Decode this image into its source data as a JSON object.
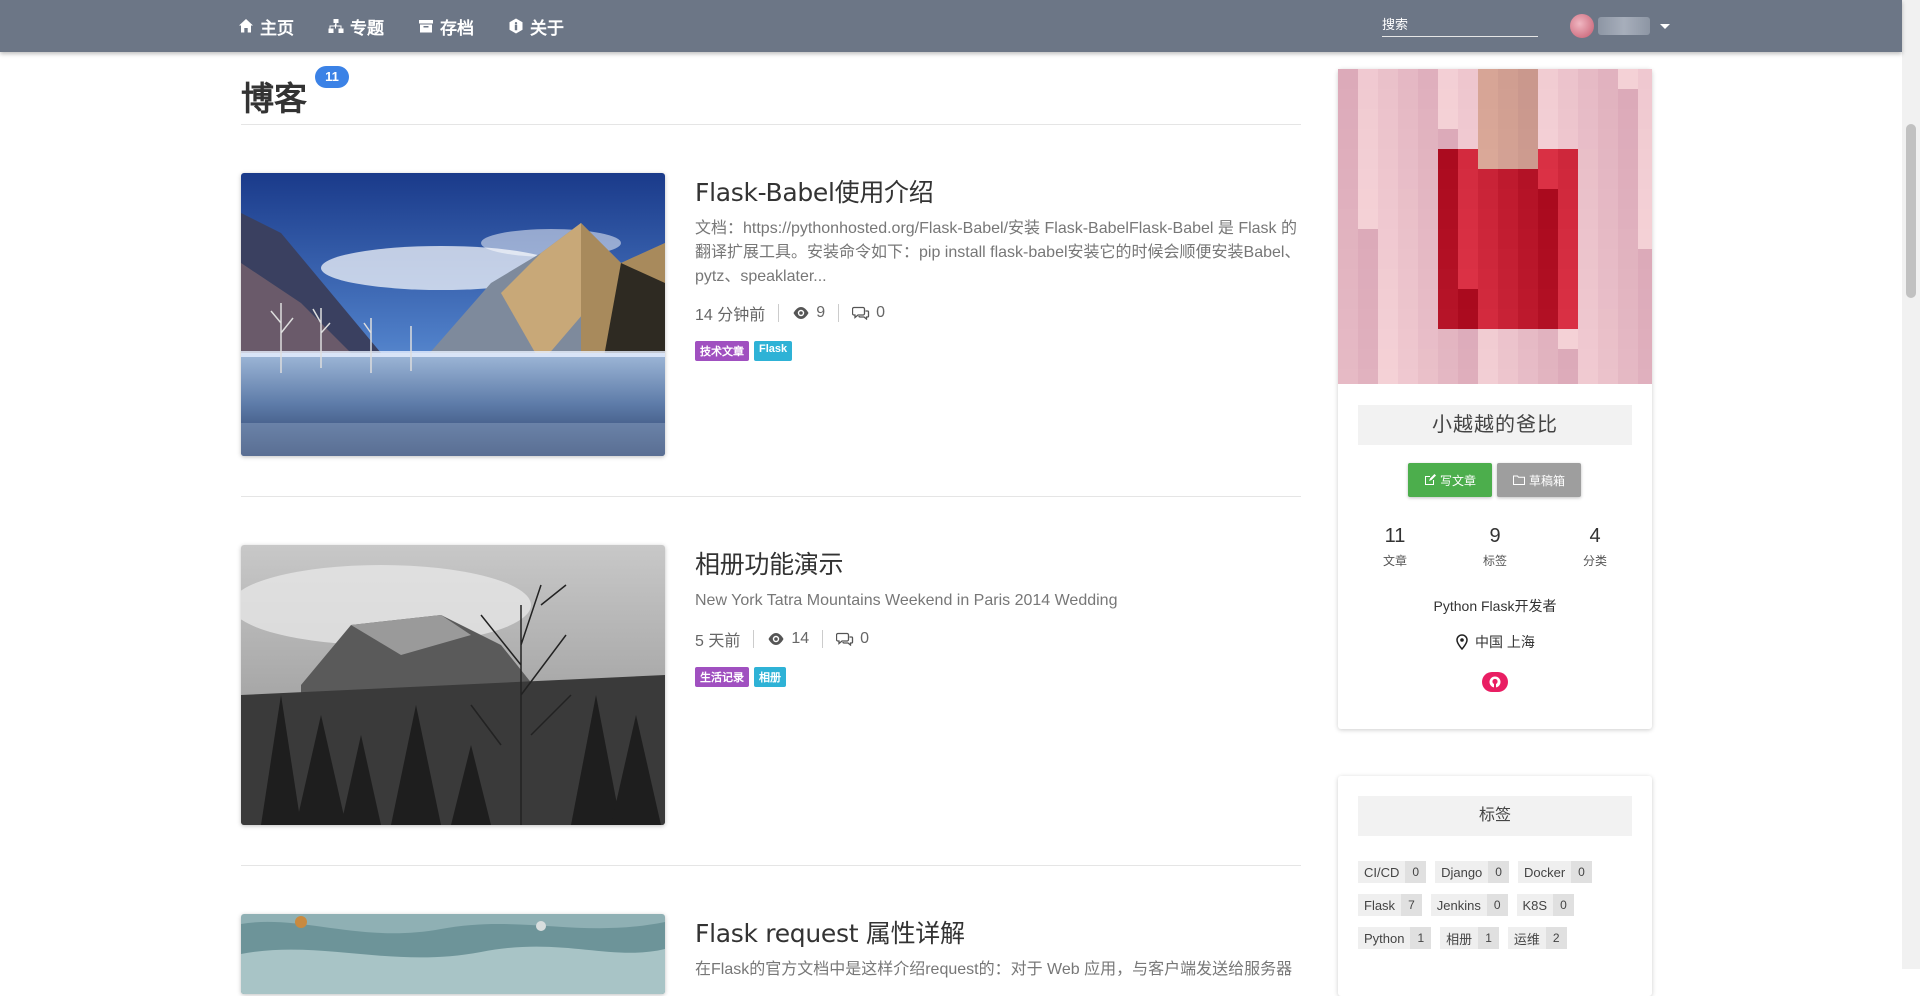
{
  "nav": {
    "items": [
      {
        "label": "主页",
        "icon": "home-icon"
      },
      {
        "label": "专题",
        "icon": "sitemap-icon"
      },
      {
        "label": "存档",
        "icon": "archive-icon"
      },
      {
        "label": "关于",
        "icon": "info-icon"
      }
    ],
    "search_placeholder": "搜索"
  },
  "page": {
    "title": "博客",
    "post_count": "11"
  },
  "posts": [
    {
      "title": "Flask-Babel使用介绍",
      "summary": "文档：https://pythonhosted.org/Flask-Babel/安装 Flask-BabelFlask-Babel 是 Flask 的翻译扩展工具。安装命令如下：pip install flask-babel安装它的时候会顺便安装Babel、pytz、speaklater...",
      "time": "14 分钟前",
      "views": "9",
      "comments": "0",
      "tags": [
        "技术文章",
        "Flask"
      ]
    },
    {
      "title": "相册功能演示",
      "summary": "New York Tatra Mountains Weekend in Paris 2014 Wedding",
      "time": "5 天前",
      "views": "14",
      "comments": "0",
      "tags": [
        "生活记录",
        "相册"
      ]
    },
    {
      "title": "Flask request 属性详解",
      "summary": "在Flask的官方文档中是这样介绍request的：对于 Web 应用，与客户端发送给服务器"
    }
  ],
  "profile": {
    "name": "小越越的爸比",
    "write_label": "写文章",
    "drafts_label": "草稿箱",
    "stats": [
      {
        "num": "11",
        "label": "文章"
      },
      {
        "num": "9",
        "label": "标签"
      },
      {
        "num": "4",
        "label": "分类"
      }
    ],
    "bio": "Python Flask开发者",
    "location": "中国 上海"
  },
  "tag_card": {
    "title": "标签",
    "tags": [
      {
        "name": "CI/CD",
        "count": "0"
      },
      {
        "name": "Django",
        "count": "0"
      },
      {
        "name": "Docker",
        "count": "0"
      },
      {
        "name": "Flask",
        "count": "7"
      },
      {
        "name": "Jenkins",
        "count": "0"
      },
      {
        "name": "K8S",
        "count": "0"
      },
      {
        "name": "Python",
        "count": "1"
      },
      {
        "name": "相册",
        "count": "1"
      },
      {
        "name": "运维",
        "count": "2"
      }
    ]
  },
  "colors": {
    "navbar": "#6c7686",
    "badge": "#3b82e6",
    "tag_purple": "#a050c0",
    "tag_cyan": "#2eb2d6",
    "write_button": "#4cae4c",
    "drafts_button": "#9e9e9e",
    "github_button": "#e91e63"
  }
}
